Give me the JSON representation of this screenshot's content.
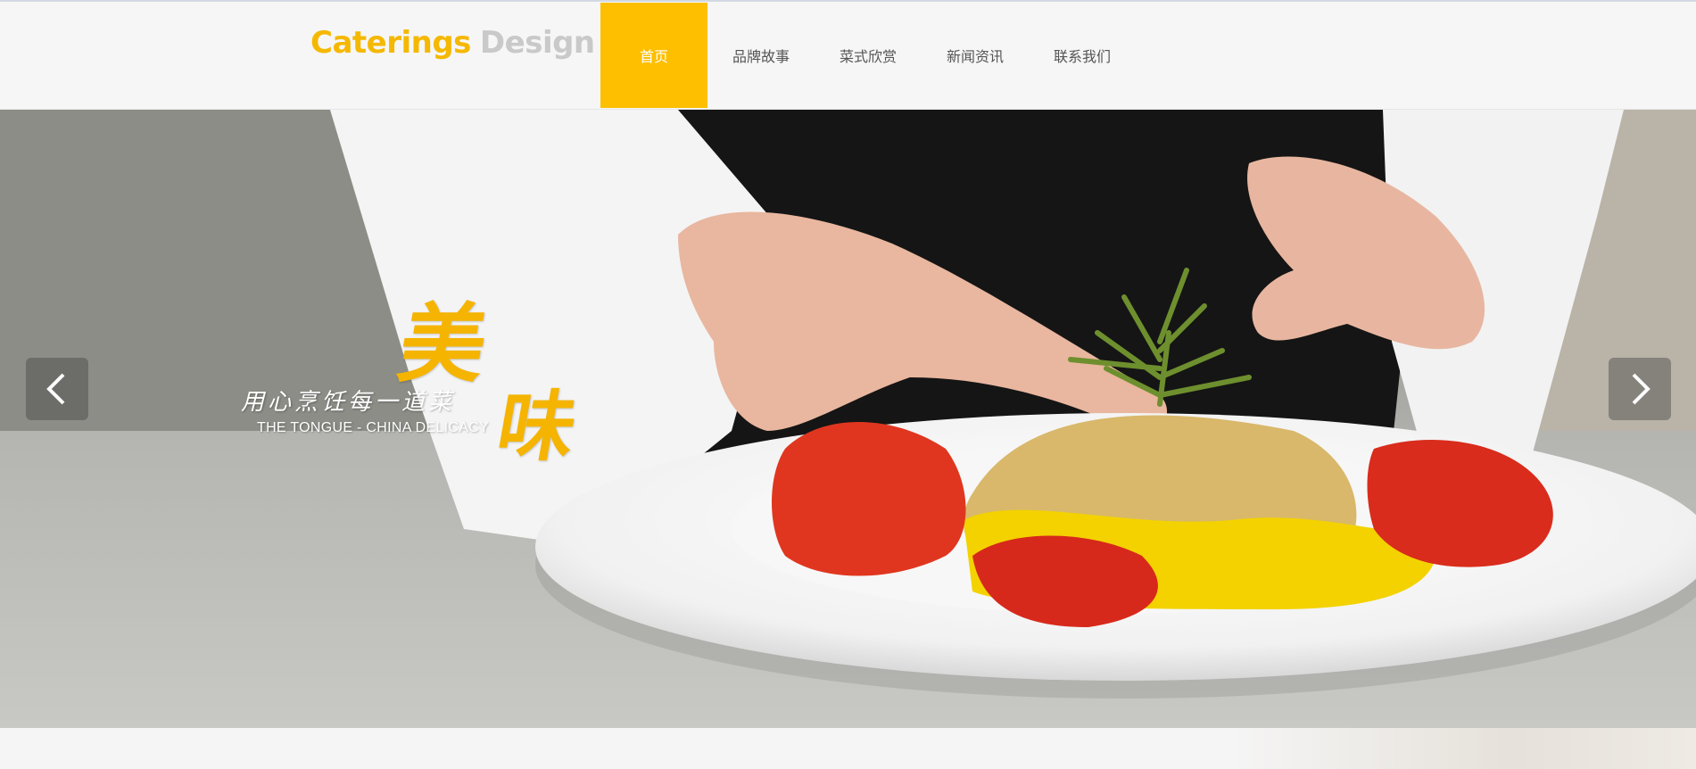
{
  "header": {
    "logo": {
      "word1": "Caterings",
      "word2": "Design"
    },
    "nav": [
      {
        "label": "首页",
        "active": true
      },
      {
        "label": "品牌故事",
        "active": false
      },
      {
        "label": "菜式欣赏",
        "active": false
      },
      {
        "label": "新闻资讯",
        "active": false
      },
      {
        "label": "联系我们",
        "active": false
      }
    ]
  },
  "banner": {
    "char_large_1": "美",
    "char_large_2": "味",
    "tagline_cn": "用心烹饪每一道菜",
    "tagline_en": "THE TONGUE - CHINA DELICACY",
    "prev_icon": "chevron-left-icon",
    "next_icon": "chevron-right-icon"
  },
  "colors": {
    "accent": "#fdbf00",
    "logo_primary": "#f5b800",
    "logo_secondary": "#c9c9c9",
    "header_bg": "#f6f6f6"
  }
}
